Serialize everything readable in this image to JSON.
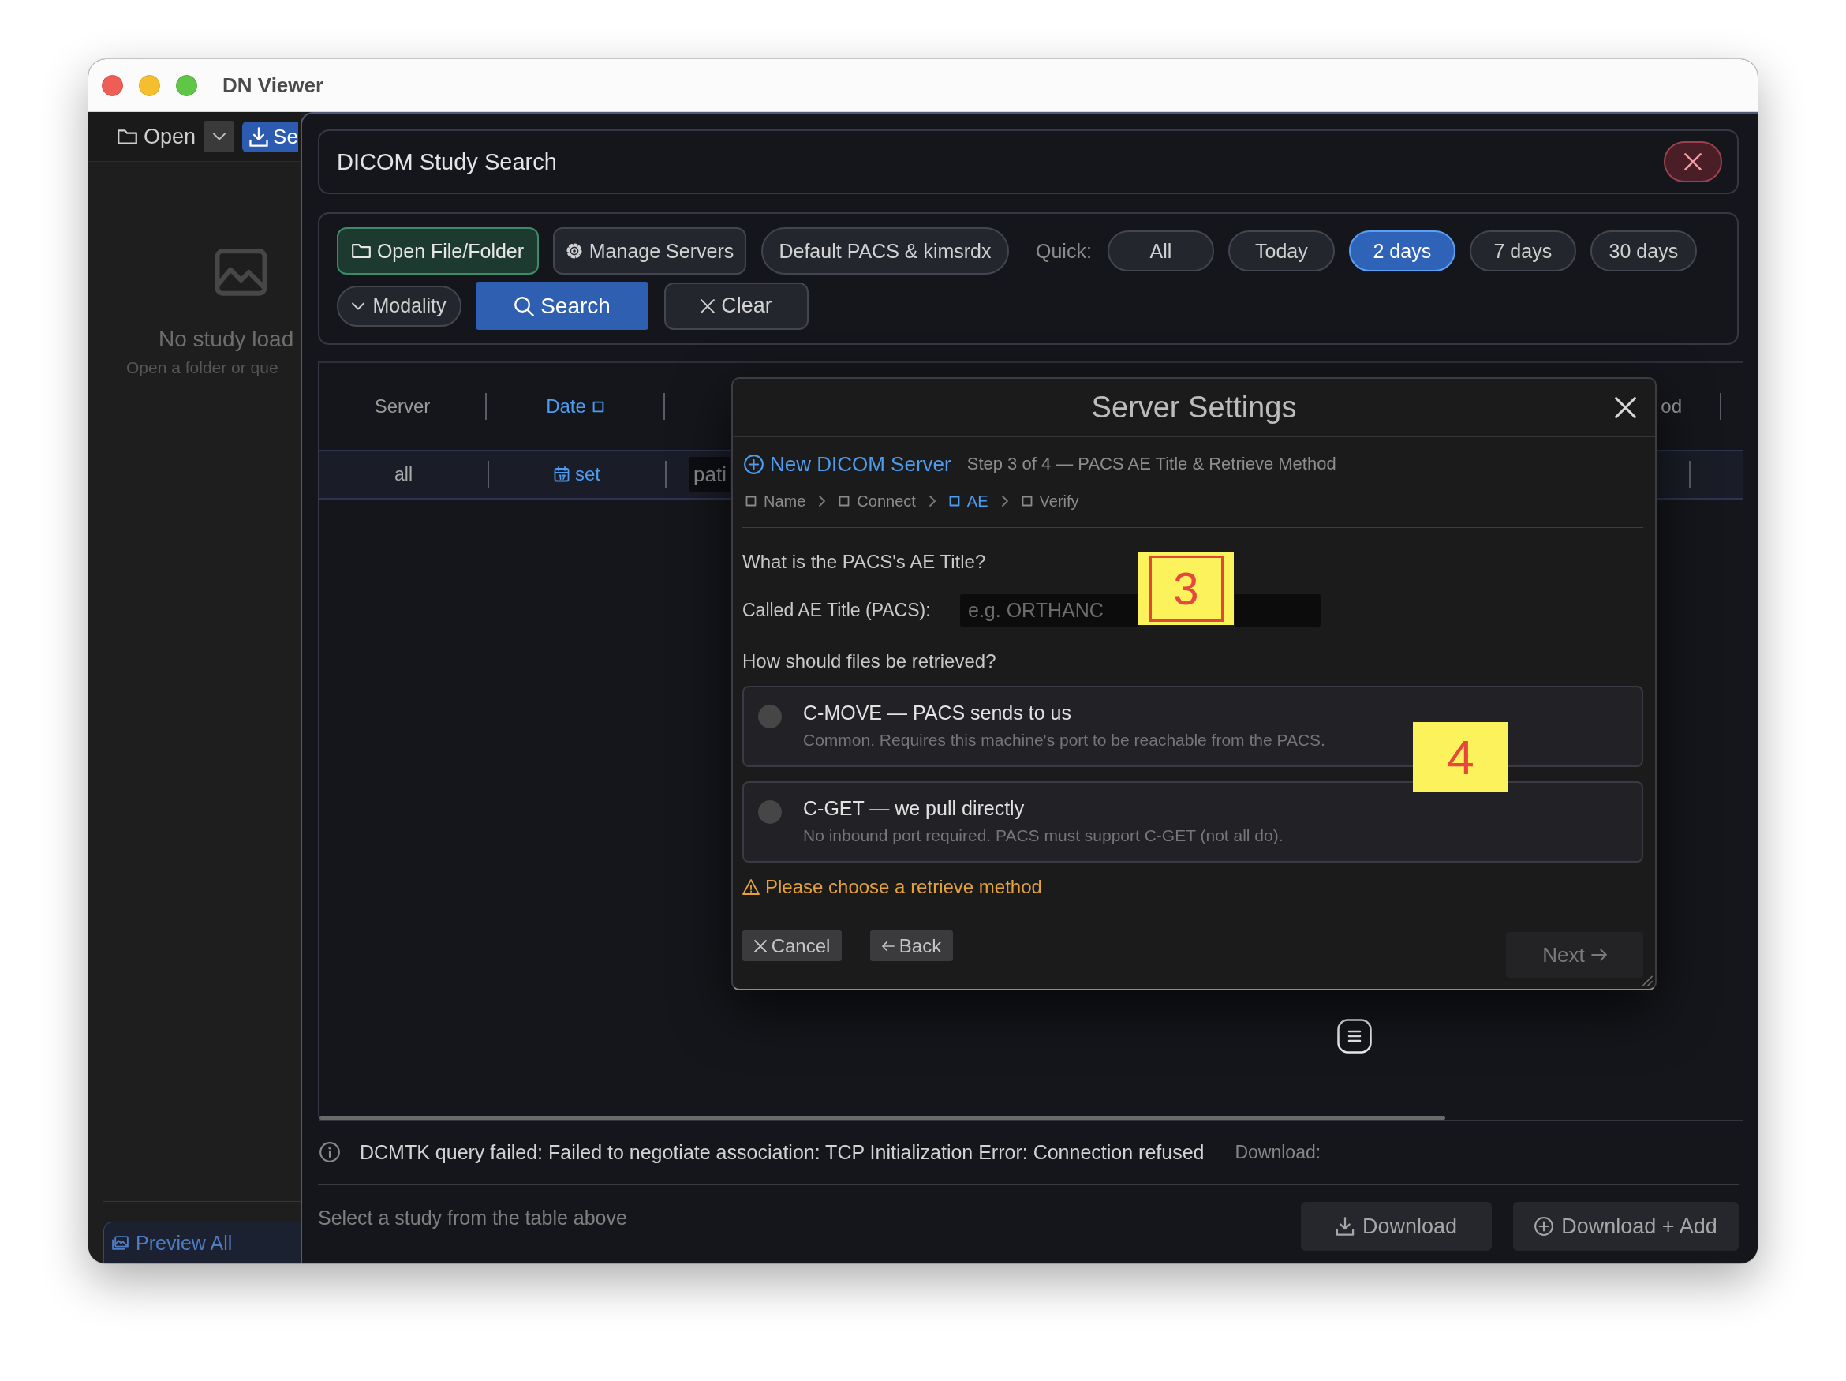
{
  "window": {
    "title": "DN Viewer"
  },
  "sidebar": {
    "toolbar": [
      {
        "kind": "open",
        "label": "Open"
      },
      {
        "kind": "dropdown"
      },
      {
        "kind": "primary",
        "label": "Se"
      }
    ],
    "empty_state": {
      "title": "No study load",
      "subtitle": "Open a folder or que"
    },
    "preview_button": "Preview All"
  },
  "study_search": {
    "title": "DICOM Study Search",
    "toolbar": {
      "buttons": [
        {
          "kind": "open",
          "label": "Open File/Folder"
        },
        {
          "kind": "servers",
          "label": "Manage Servers"
        },
        {
          "kind": "server",
          "label": "Default PACS & kimsrdx"
        }
      ],
      "quick_label": "Quick:",
      "quick_ranges": [
        {
          "label": "All",
          "selected": false
        },
        {
          "label": "Today",
          "selected": false
        },
        {
          "label": "2 days",
          "selected": true
        },
        {
          "label": "7 days",
          "selected": false
        },
        {
          "label": "30 days",
          "selected": false
        }
      ],
      "actions": [
        {
          "kind": "dropdown",
          "label": "Modality"
        },
        {
          "kind": "search",
          "label": "Search"
        },
        {
          "kind": "clear",
          "label": "Clear"
        }
      ]
    },
    "table": {
      "columns": [
        {
          "label": "Server",
          "sorted": false
        },
        {
          "label": "Date",
          "sorted": true
        },
        {
          "label": "od",
          "sorted": false
        }
      ],
      "filters": [
        {
          "kind": "select",
          "value": "all"
        },
        {
          "kind": "date",
          "value": "set"
        },
        {
          "kind": "text",
          "placeholder": "pati"
        }
      ]
    },
    "status": {
      "message": "DCMTK query failed: Failed to negotiate association: TCP Initialization Error: Connection refused",
      "download_label": "Download:"
    },
    "footer": {
      "hint": "Select a study from the table above",
      "buttons": [
        {
          "kind": "download",
          "label": "Download"
        },
        {
          "kind": "add",
          "label": "Download + Add"
        }
      ]
    }
  },
  "server_settings": {
    "title": "Server Settings",
    "heading": "New DICOM Server",
    "step_text": "Step 3 of 4 — PACS AE Title & Retrieve Method",
    "steps": [
      {
        "label": "Name",
        "selected": false
      },
      {
        "label": "Connect",
        "selected": false
      },
      {
        "label": "AE",
        "selected": true
      },
      {
        "label": "Verify",
        "selected": false
      }
    ],
    "ae_question": "What is the PACS's AE Title?",
    "ae_field": {
      "label": "Called AE Title (PACS):",
      "placeholder": "e.g. ORTHANC"
    },
    "retrieve_question": "How should files be retrieved?",
    "methods": [
      {
        "title": "C-MOVE — PACS sends to us",
        "description": "Common. Requires this machine's port to be reachable from the PACS.",
        "selected": false
      },
      {
        "title": "C-GET — we pull directly",
        "description": "No inbound port required. PACS must support C-GET (not all do).",
        "selected": false
      }
    ],
    "warning": "Please choose a retrieve method",
    "buttons": [
      {
        "kind": "cancel",
        "label": "Cancel",
        "disabled": false
      },
      {
        "kind": "back",
        "label": "Back",
        "disabled": false
      },
      {
        "kind": "next",
        "label": "Next",
        "disabled": true
      }
    ]
  },
  "callouts": [
    {
      "label": "3",
      "framed": true
    },
    {
      "label": "4",
      "framed": false
    }
  ]
}
